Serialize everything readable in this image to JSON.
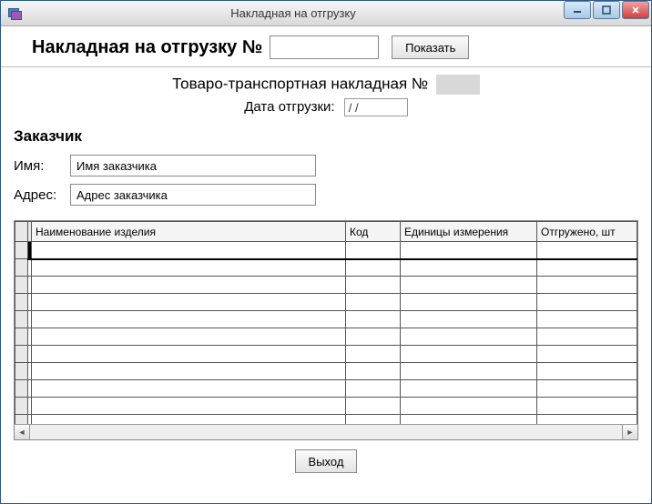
{
  "window": {
    "title": "Накладная на отгрузку"
  },
  "header": {
    "label": "Накладная на отгрузку №",
    "number_value": "",
    "show_button": "Показать"
  },
  "subheader": {
    "ttn_label": "Товаро-транспортная накладная №",
    "ttn_value": "",
    "ship_date_label": "Дата отгрузки:",
    "ship_date_value": "/ /"
  },
  "customer": {
    "section_title": "Заказчик",
    "name_label": "Имя:",
    "name_value": "Имя заказчика",
    "address_label": "Адрес:",
    "address_value": "Адрес заказчика"
  },
  "grid": {
    "columns": [
      "Наименование изделия",
      "Код",
      "Единицы измерения",
      "Отгружено, шт"
    ],
    "rows": [
      [
        "",
        "",
        "",
        ""
      ],
      [
        "",
        "",
        "",
        ""
      ],
      [
        "",
        "",
        "",
        ""
      ],
      [
        "",
        "",
        "",
        ""
      ],
      [
        "",
        "",
        "",
        ""
      ],
      [
        "",
        "",
        "",
        ""
      ],
      [
        "",
        "",
        "",
        ""
      ],
      [
        "",
        "",
        "",
        ""
      ],
      [
        "",
        "",
        "",
        ""
      ],
      [
        "",
        "",
        "",
        ""
      ],
      [
        "",
        "",
        "",
        ""
      ]
    ]
  },
  "footer": {
    "exit_button": "Выход"
  }
}
